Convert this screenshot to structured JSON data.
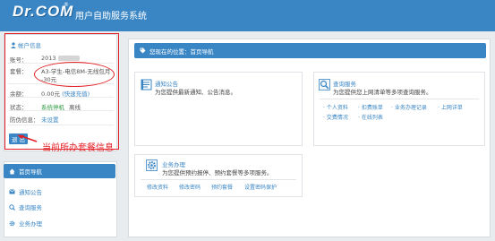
{
  "header": {
    "logo": "Dr.COM",
    "logo_mark": "®",
    "title": "用户自助服务系统",
    "bg_color": "#3a86c5"
  },
  "account": {
    "heading": "帐户信息",
    "heading_icon": "user-icon",
    "rows": [
      {
        "label": "账号：",
        "value": "2013"
      },
      {
        "label": "套餐：",
        "value_line1": "A3-学生-电信8M-无线包月",
        "value_line2": "-30元"
      },
      {
        "label": "余额：",
        "value": "0.00元",
        "extra": "(快速充值)"
      },
      {
        "label": "状态：",
        "value": "系统停机",
        "extra": "离线"
      },
      {
        "label": "防伪信息：",
        "value": "未设置"
      }
    ],
    "logout": "退 出"
  },
  "annotation": {
    "note": "当前所办套餐信息",
    "color": "#e31e24"
  },
  "nav": {
    "items": [
      {
        "label": "首页导航",
        "icon": "home-icon",
        "active": true
      },
      {
        "label": "通知公告",
        "icon": "envelope-icon"
      },
      {
        "label": "查询服务",
        "icon": "search-icon"
      },
      {
        "label": "业务办理",
        "icon": "gear-icon"
      }
    ]
  },
  "main": {
    "breadcrumb": "您现在的位置：首页导航",
    "breadcrumb_icon": "tag-icon",
    "cards": {
      "notice": {
        "title": "通知公告",
        "desc": "为您提供最新通知、公告消息。",
        "icon": "notebook-icon"
      },
      "query": {
        "title": "查询服务",
        "desc": "为您提供您上网清单等多项查询服务。",
        "icon": "search-icon",
        "links": [
          "· 个人资料",
          "· 扣费账单",
          "· 业务办理记录",
          "· 上网详单",
          "· 交费情况",
          "· 在线列表"
        ]
      },
      "business": {
        "title": "业务办理",
        "desc": "为您提供预约报停、预约套餐等多项服务。",
        "icon": "gear-icon",
        "links": [
          "修改资料",
          "修改密码",
          "预约套餐",
          "设置密码保护"
        ]
      }
    }
  }
}
